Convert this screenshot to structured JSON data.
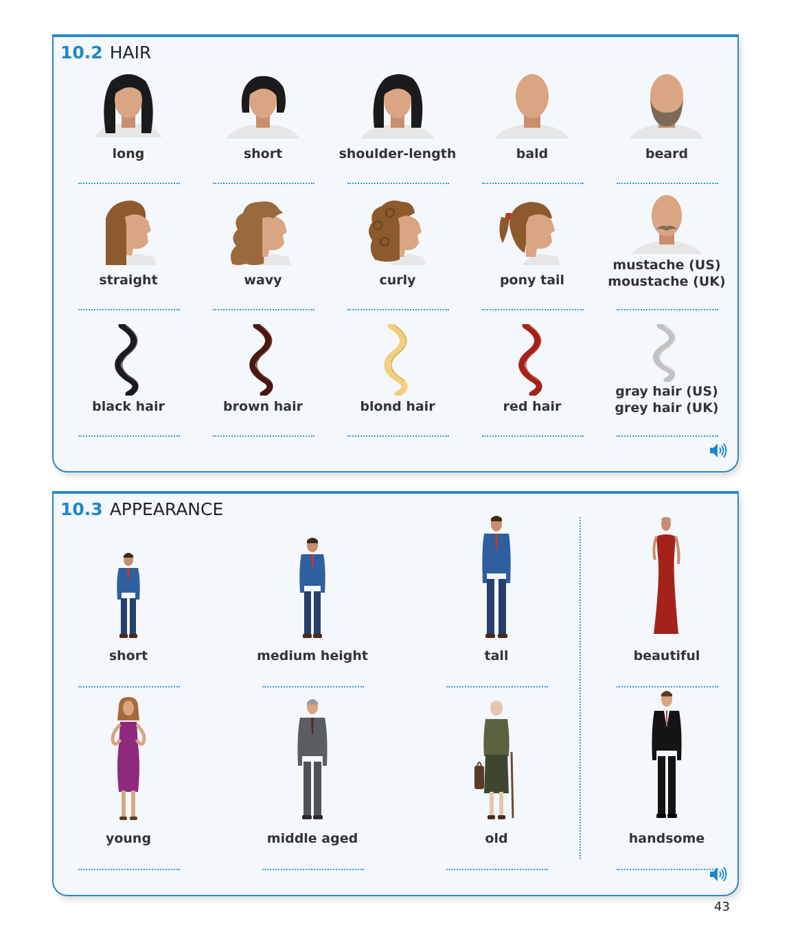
{
  "hair": {
    "section_number": "10.2",
    "section_title": "HAIR",
    "items": [
      {
        "label": "long",
        "label2": ""
      },
      {
        "label": "short",
        "label2": ""
      },
      {
        "label": "shoulder-length",
        "label2": ""
      },
      {
        "label": "bald",
        "label2": ""
      },
      {
        "label": "beard",
        "label2": ""
      },
      {
        "label": "straight",
        "label2": ""
      },
      {
        "label": "wavy",
        "label2": ""
      },
      {
        "label": "curly",
        "label2": ""
      },
      {
        "label": "pony tail",
        "label2": ""
      },
      {
        "label": "mustache (US)",
        "label2": "moustache (UK)"
      },
      {
        "label": "black hair",
        "label2": ""
      },
      {
        "label": "brown hair",
        "label2": ""
      },
      {
        "label": "blond hair",
        "label2": ""
      },
      {
        "label": "red hair",
        "label2": ""
      },
      {
        "label": "gray hair (US)",
        "label2": "grey hair (UK)"
      }
    ],
    "icon": "speaker-icon"
  },
  "appearance": {
    "section_number": "10.3",
    "section_title": "APPEARANCE",
    "items": [
      {
        "label": "short"
      },
      {
        "label": "medium height"
      },
      {
        "label": "tall"
      },
      {
        "label": "beautiful"
      },
      {
        "label": "young"
      },
      {
        "label": "middle aged"
      },
      {
        "label": "old"
      },
      {
        "label": "handsome"
      }
    ],
    "icon": "speaker-icon"
  },
  "page_number": "43",
  "colors": {
    "accent": "#1c87c9",
    "panel_bg": "#f4f7fb",
    "skin": "#d9a582",
    "hair_black": "#1b1b1b",
    "hair_brown": "#8d5a2e",
    "hair_blond": "#f2cf7e",
    "hair_red": "#a3231b",
    "hair_gray": "#bdbdbd"
  }
}
